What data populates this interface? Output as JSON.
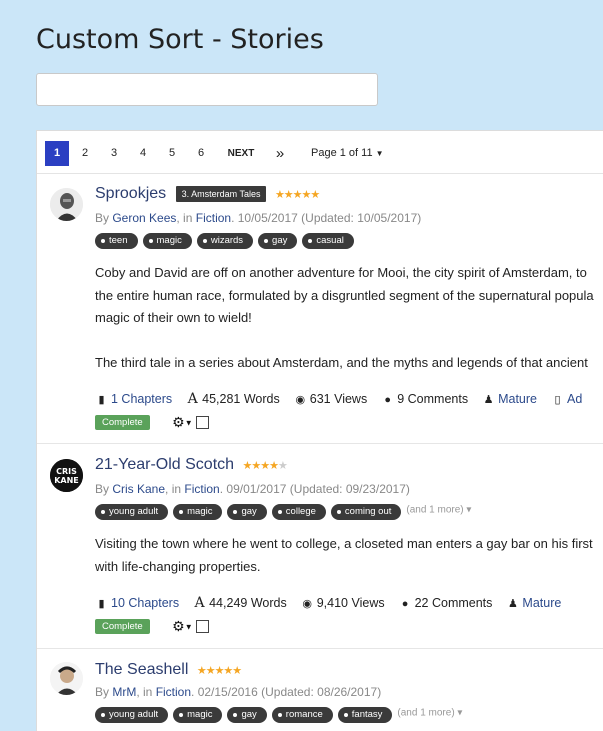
{
  "page": {
    "title": "Custom Sort - Stories"
  },
  "search": {
    "value": "",
    "placeholder": ""
  },
  "pagination": {
    "pages": [
      "1",
      "2",
      "3",
      "4",
      "5",
      "6"
    ],
    "active": "1",
    "next_label": "NEXT",
    "last_label": "»",
    "page_info": "Page 1 of 11"
  },
  "stories": [
    {
      "title": "Sprookjes",
      "series": "3. Amsterdam Tales",
      "rating": 5,
      "author": "Geron Kees",
      "category": "Fiction",
      "date": "10/05/2017",
      "updated": "(Updated: 10/05/2017)",
      "tags": [
        "teen",
        "magic",
        "wizards",
        "gay",
        "casual"
      ],
      "more_tags": "",
      "description": [
        "Coby and David are off on another adventure for Mooi, the city spirit of Amsterdam, to",
        "the entire human race, formulated by a disgruntled segment of the supernatural popula",
        "magic of their own to wield!",
        "The third tale in a series about Amsterdam, and the myths and legends of that ancient"
      ],
      "chapters": "1 Chapters",
      "words": "45,281 Words",
      "views": "631 Views",
      "comments": "9 Comments",
      "rating_label": "Mature",
      "extra": "Ad",
      "status": "Complete"
    },
    {
      "title": "21-Year-Old Scotch",
      "series": "",
      "rating": 4.5,
      "author": "Cris Kane",
      "category": "Fiction",
      "date": "09/01/2017",
      "updated": "(Updated: 09/23/2017)",
      "tags": [
        "young adult",
        "magic",
        "gay",
        "college",
        "coming out"
      ],
      "more_tags": "(and 1 more) ▾",
      "description": [
        "Visiting the town where he went to college, a closeted man enters a gay bar on his first",
        "with life-changing properties."
      ],
      "chapters": "10 Chapters",
      "words": "44,249 Words",
      "views": "9,410 Views",
      "comments": "22 Comments",
      "rating_label": "Mature",
      "extra": "",
      "status": "Complete"
    },
    {
      "title": "The Seashell",
      "series": "",
      "rating": 5,
      "author": "MrM",
      "category": "Fiction",
      "date": "02/15/2016",
      "updated": "(Updated: 08/26/2017)",
      "tags": [
        "young adult",
        "magic",
        "gay",
        "romance",
        "fantasy"
      ],
      "more_tags": "(and 1 more) ▾",
      "description": [],
      "chapters": "",
      "words": "",
      "views": "",
      "comments": "",
      "rating_label": "",
      "extra": "",
      "status": ""
    }
  ],
  "colors": {
    "background": "#cbe6f8",
    "pager_active": "#2b3fc2",
    "link": "#2c4a8b",
    "complete_badge": "#5aa25a",
    "star": "#f5a623"
  },
  "icons": {
    "chapters": "book-icon",
    "words": "font-icon",
    "views": "eye-icon",
    "comments": "comment-icon",
    "rating": "user-icon",
    "extra": "file-icon",
    "settings": "gear-icon"
  }
}
